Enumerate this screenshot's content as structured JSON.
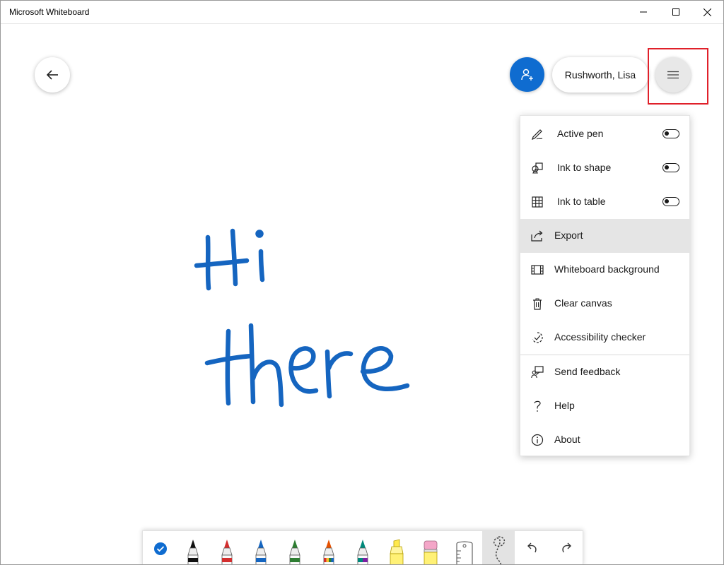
{
  "window": {
    "title": "Microsoft Whiteboard"
  },
  "header": {
    "user_name": "Rushworth, Lisa"
  },
  "canvas": {
    "ink_lines": [
      "Hi",
      "there"
    ],
    "ink_color": "#1565c0"
  },
  "menu": {
    "items": [
      {
        "label": "Active pen",
        "icon": "pen-icon",
        "toggle": true
      },
      {
        "label": "Ink to shape",
        "icon": "shapes-icon",
        "toggle": true
      },
      {
        "label": "Ink to table",
        "icon": "table-icon",
        "toggle": true
      },
      {
        "label": "Export",
        "icon": "share-icon",
        "selected": true
      },
      {
        "label": "Whiteboard background",
        "icon": "background-icon"
      },
      {
        "label": "Clear canvas",
        "icon": "trash-icon"
      },
      {
        "label": "Accessibility checker",
        "icon": "accessibility-icon"
      },
      {
        "label": "Send feedback",
        "icon": "feedback-icon"
      },
      {
        "label": "Help",
        "icon": "help-icon"
      },
      {
        "label": "About",
        "icon": "info-icon"
      }
    ]
  },
  "toolbar": {
    "tools": [
      {
        "name": "ink-toggle",
        "icon": "check-icon",
        "color": "#0f6cd0"
      },
      {
        "name": "pen-black",
        "icon": "pen-icon",
        "color": "#111111"
      },
      {
        "name": "pen-red",
        "icon": "pen-icon",
        "color": "#d32f2f"
      },
      {
        "name": "pen-blue",
        "icon": "pen-icon",
        "color": "#1565c0"
      },
      {
        "name": "pen-green",
        "icon": "pen-icon",
        "color": "#2e7d32"
      },
      {
        "name": "pen-rainbow",
        "icon": "pen-icon",
        "color": "#e65100"
      },
      {
        "name": "pen-galaxy",
        "icon": "pen-icon",
        "color": "#00897b"
      },
      {
        "name": "highlighter",
        "icon": "highlighter-icon",
        "color": "#ffe94d"
      },
      {
        "name": "eraser",
        "icon": "eraser-icon",
        "color": "#f4a6c8"
      },
      {
        "name": "ruler",
        "icon": "ruler-icon",
        "color": "#ffffff"
      },
      {
        "name": "lasso",
        "icon": "lasso-icon",
        "color": "#444444"
      },
      {
        "name": "undo",
        "icon": "undo-icon",
        "color": "#333333"
      },
      {
        "name": "redo",
        "icon": "redo-icon",
        "color": "#333333"
      }
    ]
  },
  "colors": {
    "accent": "#0f6cd0",
    "highlight_box": "#e0202a",
    "menu_selected": "#e5e5e5"
  }
}
